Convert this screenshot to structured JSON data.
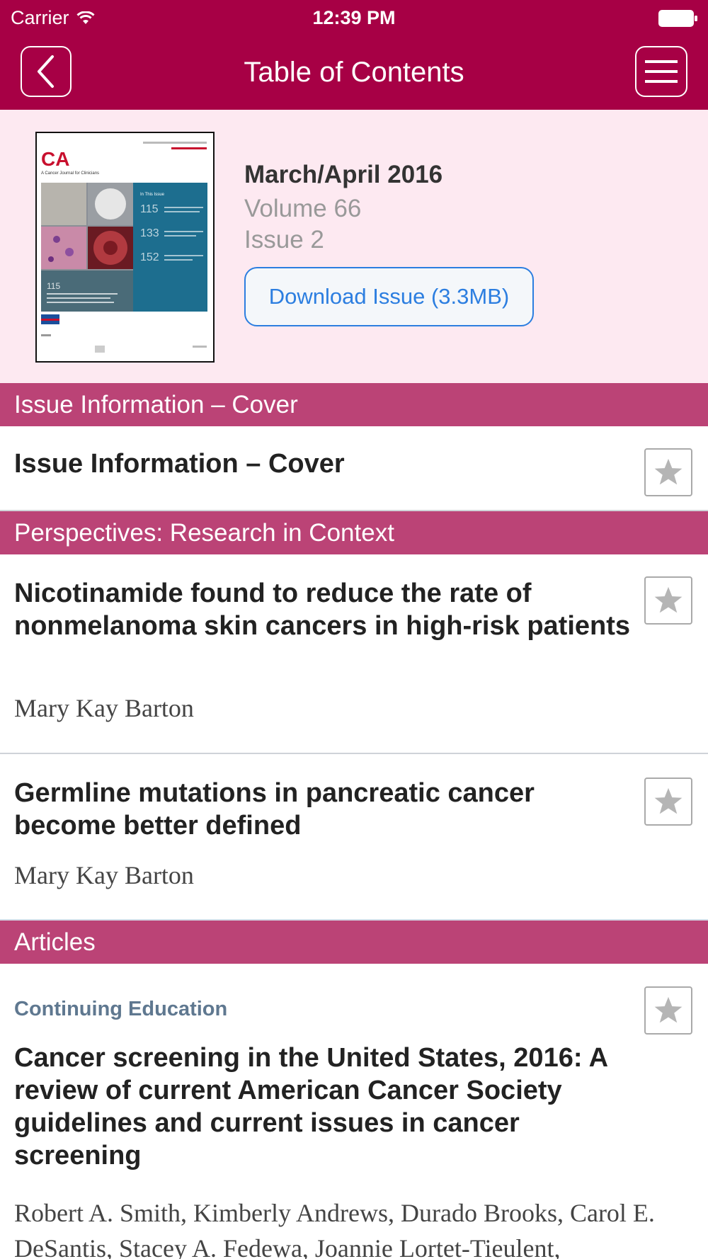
{
  "status_bar": {
    "carrier": "Carrier",
    "time": "12:39 PM"
  },
  "nav": {
    "title": "Table of Contents",
    "back_icon": "chevron-left-icon",
    "menu_icon": "hamburger-menu-icon"
  },
  "issue": {
    "date": "March/April 2016",
    "volume": "Volume 66",
    "issue": "Issue 2",
    "download_label": "Download Issue (3.3MB)",
    "cover_logo": "CA",
    "cover_subtitle": "A Cancer Journal for Clinicians",
    "cover_numbers": [
      "115",
      "133",
      "152"
    ],
    "cover_feature_number": "115"
  },
  "sections": [
    {
      "label": "Issue Information – Cover",
      "articles": [
        {
          "title": "Issue Information – Cover"
        }
      ]
    },
    {
      "label": "Perspectives: Research in Context",
      "articles": [
        {
          "title": "Nicotinamide found to reduce the rate of nonmelanoma skin cancers in high-risk patients",
          "authors": "Mary Kay Barton"
        },
        {
          "title": "Germline mutations in pancreatic cancer become better defined",
          "authors": "Mary Kay Barton"
        }
      ]
    },
    {
      "label": "Articles",
      "articles": [
        {
          "category": "Continuing Education",
          "title": "Cancer screening in the United States, 2016: A review of current American Cancer Society guidelines and current issues in cancer screening",
          "authors": "Robert A. Smith, Kimberly Andrews, Durado Brooks, Carol E. DeSantis, Stacey A. Fedewa, Joannie Lortet-Tieulent,"
        }
      ]
    }
  ],
  "colors": {
    "nav_bar": "#a70045",
    "section_header": "#bb4376",
    "header_bg": "#fde9f1",
    "link_blue": "#2c7ee0"
  }
}
